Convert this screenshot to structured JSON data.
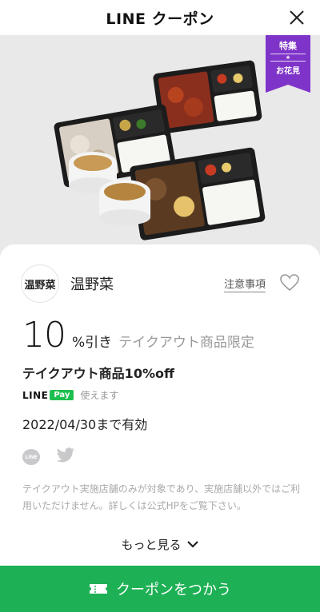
{
  "header": {
    "title": "LINE クーポン"
  },
  "badge": {
    "line1": "特集",
    "star": "★",
    "line2": "お花見",
    "color": "#7f34c9"
  },
  "store": {
    "logo_text": "温野菜",
    "name": "温野菜",
    "notes_label": "注意事項"
  },
  "discount": {
    "number": "10",
    "unit": "%引き",
    "note": "テイクアウト商品限定"
  },
  "coupon": {
    "title": "テイクアウト商品10%off"
  },
  "pay": {
    "line": "LINE",
    "box": "Pay",
    "usable": "使えます"
  },
  "expiry": "2022/04/30まで有効",
  "share": {
    "line_text": "LINE"
  },
  "description": "テイクアウト実施店舗のみが対象であり、実施店舗以外ではご利用いただけません。詳しくは公式HPをご覧下さい。",
  "more_label": "もっと見る",
  "cta": {
    "label": "クーポンをつかう",
    "color": "#1eb055"
  },
  "icons": {
    "close": "close-icon",
    "heart": "heart-icon",
    "twitter": "twitter-icon",
    "chevron": "chevron-down-icon",
    "ticket": "ticket-icon"
  }
}
